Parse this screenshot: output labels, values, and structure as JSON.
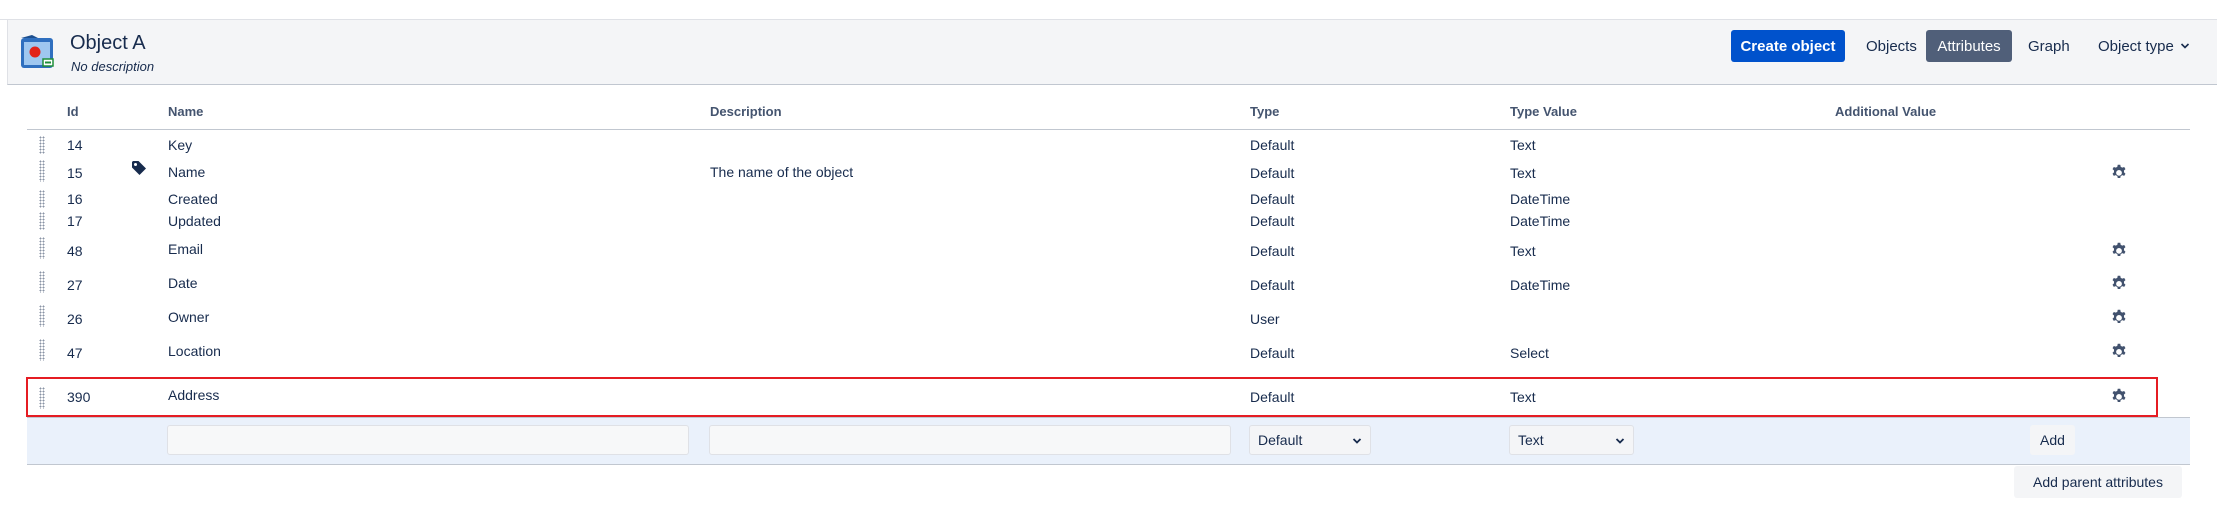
{
  "header": {
    "object_name": "Object A",
    "object_description": "No description",
    "create_button": "Create object",
    "tabs": {
      "objects": "Objects",
      "attributes": "Attributes",
      "graph": "Graph",
      "object_type": "Object type"
    }
  },
  "table": {
    "columns": {
      "id": "Id",
      "name": "Name",
      "description": "Description",
      "type": "Type",
      "type_value": "Type Value",
      "additional_value": "Additional Value"
    },
    "rows": [
      {
        "id": "14",
        "name": "Key",
        "description": "",
        "type": "Default",
        "type_value": "Text",
        "label_icon": false,
        "settings": false
      },
      {
        "id": "15",
        "name": "Name",
        "description": "The name of the object",
        "type": "Default",
        "type_value": "Text",
        "label_icon": true,
        "settings": true
      },
      {
        "id": "16",
        "name": "Created",
        "description": "",
        "type": "Default",
        "type_value": "DateTime",
        "label_icon": false,
        "settings": false
      },
      {
        "id": "17",
        "name": "Updated",
        "description": "",
        "type": "Default",
        "type_value": "DateTime",
        "label_icon": false,
        "settings": false
      },
      {
        "id": "48",
        "name": "Email",
        "description": "",
        "type": "Default",
        "type_value": "Text",
        "label_icon": false,
        "settings": true
      },
      {
        "id": "27",
        "name": "Date",
        "description": "",
        "type": "Default",
        "type_value": "DateTime",
        "label_icon": false,
        "settings": true
      },
      {
        "id": "26",
        "name": "Owner",
        "description": "",
        "type": "User",
        "type_value": "",
        "label_icon": false,
        "settings": true
      },
      {
        "id": "47",
        "name": "Location",
        "description": "",
        "type": "Default",
        "type_value": "Select",
        "label_icon": false,
        "settings": true
      },
      {
        "id": "390",
        "name": "Address",
        "description": "",
        "type": "Default",
        "type_value": "Text",
        "label_icon": false,
        "settings": true
      }
    ],
    "highlighted_row": "390"
  },
  "add_row": {
    "name_value": "",
    "description_value": "",
    "type_selected": "Default",
    "type_value_selected": "Text",
    "add_button": "Add"
  },
  "add_parent_button": "Add parent attributes",
  "colors": {
    "primary": "#0052cc",
    "active_tab": "#505f79",
    "highlight_border": "#e51c23"
  }
}
